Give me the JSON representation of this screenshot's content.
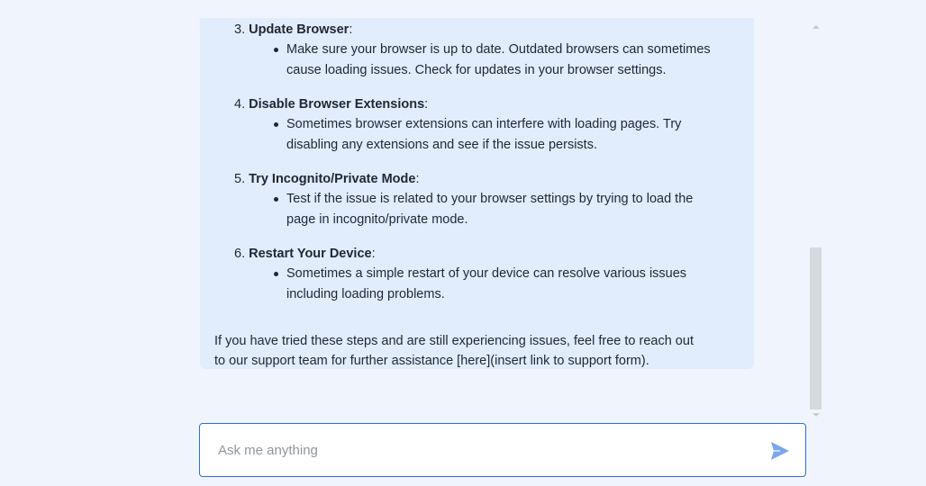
{
  "message": {
    "steps": [
      {
        "number": "3.",
        "title": "Update Browser",
        "suffix": ":",
        "bullet_lines": [
          "Make sure your browser is up to date. Outdated browsers can sometimes",
          "cause loading issues. Check for updates in your browser settings."
        ]
      },
      {
        "number": "4.",
        "title": "Disable Browser Extensions",
        "suffix": ":",
        "bullet_lines": [
          "Sometimes browser extensions can interfere with loading pages. Try",
          "disabling any extensions and see if the issue persists."
        ]
      },
      {
        "number": "5.",
        "title": "Try Incognito/Private Mode",
        "suffix": ":",
        "bullet_lines": [
          "Test if the issue is related to your browser settings by trying to load the",
          "page in incognito/private mode."
        ]
      },
      {
        "number": "6.",
        "title": "Restart Your Device",
        "suffix": ":",
        "bullet_lines": [
          "Sometimes a simple restart of your device can resolve various issues",
          "including loading problems."
        ]
      }
    ],
    "closing_lines": [
      "If you have tried these steps and are still experiencing issues, feel free to reach out",
      "to our support team for further assistance [here](insert link to support form)."
    ]
  },
  "composer": {
    "placeholder": "Ask me anything",
    "value": "",
    "send_icon": "send-icon"
  },
  "colors": {
    "page_background": "#f0f5fd",
    "bubble_background": "#e1ecfd",
    "accent": "#2f6fd1",
    "send_icon": "#7aa7ee"
  }
}
